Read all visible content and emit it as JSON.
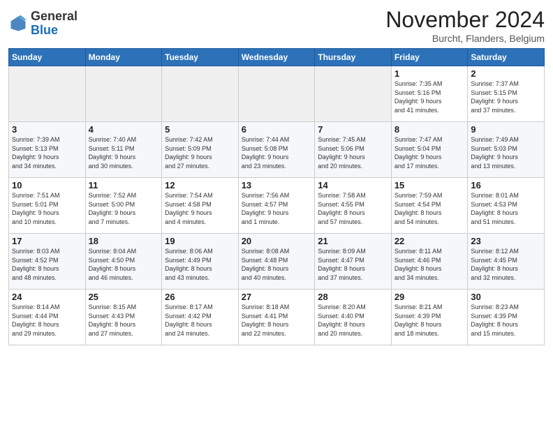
{
  "header": {
    "logo_general": "General",
    "logo_blue": "Blue",
    "month_title": "November 2024",
    "location": "Burcht, Flanders, Belgium"
  },
  "weekdays": [
    "Sunday",
    "Monday",
    "Tuesday",
    "Wednesday",
    "Thursday",
    "Friday",
    "Saturday"
  ],
  "weeks": [
    [
      {
        "day": "",
        "info": ""
      },
      {
        "day": "",
        "info": ""
      },
      {
        "day": "",
        "info": ""
      },
      {
        "day": "",
        "info": ""
      },
      {
        "day": "",
        "info": ""
      },
      {
        "day": "1",
        "info": "Sunrise: 7:35 AM\nSunset: 5:16 PM\nDaylight: 9 hours\nand 41 minutes."
      },
      {
        "day": "2",
        "info": "Sunrise: 7:37 AM\nSunset: 5:15 PM\nDaylight: 9 hours\nand 37 minutes."
      }
    ],
    [
      {
        "day": "3",
        "info": "Sunrise: 7:39 AM\nSunset: 5:13 PM\nDaylight: 9 hours\nand 34 minutes."
      },
      {
        "day": "4",
        "info": "Sunrise: 7:40 AM\nSunset: 5:11 PM\nDaylight: 9 hours\nand 30 minutes."
      },
      {
        "day": "5",
        "info": "Sunrise: 7:42 AM\nSunset: 5:09 PM\nDaylight: 9 hours\nand 27 minutes."
      },
      {
        "day": "6",
        "info": "Sunrise: 7:44 AM\nSunset: 5:08 PM\nDaylight: 9 hours\nand 23 minutes."
      },
      {
        "day": "7",
        "info": "Sunrise: 7:45 AM\nSunset: 5:06 PM\nDaylight: 9 hours\nand 20 minutes."
      },
      {
        "day": "8",
        "info": "Sunrise: 7:47 AM\nSunset: 5:04 PM\nDaylight: 9 hours\nand 17 minutes."
      },
      {
        "day": "9",
        "info": "Sunrise: 7:49 AM\nSunset: 5:03 PM\nDaylight: 9 hours\nand 13 minutes."
      }
    ],
    [
      {
        "day": "10",
        "info": "Sunrise: 7:51 AM\nSunset: 5:01 PM\nDaylight: 9 hours\nand 10 minutes."
      },
      {
        "day": "11",
        "info": "Sunrise: 7:52 AM\nSunset: 5:00 PM\nDaylight: 9 hours\nand 7 minutes."
      },
      {
        "day": "12",
        "info": "Sunrise: 7:54 AM\nSunset: 4:58 PM\nDaylight: 9 hours\nand 4 minutes."
      },
      {
        "day": "13",
        "info": "Sunrise: 7:56 AM\nSunset: 4:57 PM\nDaylight: 9 hours\nand 1 minute."
      },
      {
        "day": "14",
        "info": "Sunrise: 7:58 AM\nSunset: 4:55 PM\nDaylight: 8 hours\nand 57 minutes."
      },
      {
        "day": "15",
        "info": "Sunrise: 7:59 AM\nSunset: 4:54 PM\nDaylight: 8 hours\nand 54 minutes."
      },
      {
        "day": "16",
        "info": "Sunrise: 8:01 AM\nSunset: 4:53 PM\nDaylight: 8 hours\nand 51 minutes."
      }
    ],
    [
      {
        "day": "17",
        "info": "Sunrise: 8:03 AM\nSunset: 4:52 PM\nDaylight: 8 hours\nand 48 minutes."
      },
      {
        "day": "18",
        "info": "Sunrise: 8:04 AM\nSunset: 4:50 PM\nDaylight: 8 hours\nand 46 minutes."
      },
      {
        "day": "19",
        "info": "Sunrise: 8:06 AM\nSunset: 4:49 PM\nDaylight: 8 hours\nand 43 minutes."
      },
      {
        "day": "20",
        "info": "Sunrise: 8:08 AM\nSunset: 4:48 PM\nDaylight: 8 hours\nand 40 minutes."
      },
      {
        "day": "21",
        "info": "Sunrise: 8:09 AM\nSunset: 4:47 PM\nDaylight: 8 hours\nand 37 minutes."
      },
      {
        "day": "22",
        "info": "Sunrise: 8:11 AM\nSunset: 4:46 PM\nDaylight: 8 hours\nand 34 minutes."
      },
      {
        "day": "23",
        "info": "Sunrise: 8:12 AM\nSunset: 4:45 PM\nDaylight: 8 hours\nand 32 minutes."
      }
    ],
    [
      {
        "day": "24",
        "info": "Sunrise: 8:14 AM\nSunset: 4:44 PM\nDaylight: 8 hours\nand 29 minutes."
      },
      {
        "day": "25",
        "info": "Sunrise: 8:15 AM\nSunset: 4:43 PM\nDaylight: 8 hours\nand 27 minutes."
      },
      {
        "day": "26",
        "info": "Sunrise: 8:17 AM\nSunset: 4:42 PM\nDaylight: 8 hours\nand 24 minutes."
      },
      {
        "day": "27",
        "info": "Sunrise: 8:18 AM\nSunset: 4:41 PM\nDaylight: 8 hours\nand 22 minutes."
      },
      {
        "day": "28",
        "info": "Sunrise: 8:20 AM\nSunset: 4:40 PM\nDaylight: 8 hours\nand 20 minutes."
      },
      {
        "day": "29",
        "info": "Sunrise: 8:21 AM\nSunset: 4:39 PM\nDaylight: 8 hours\nand 18 minutes."
      },
      {
        "day": "30",
        "info": "Sunrise: 8:23 AM\nSunset: 4:39 PM\nDaylight: 8 hours\nand 15 minutes."
      }
    ]
  ]
}
